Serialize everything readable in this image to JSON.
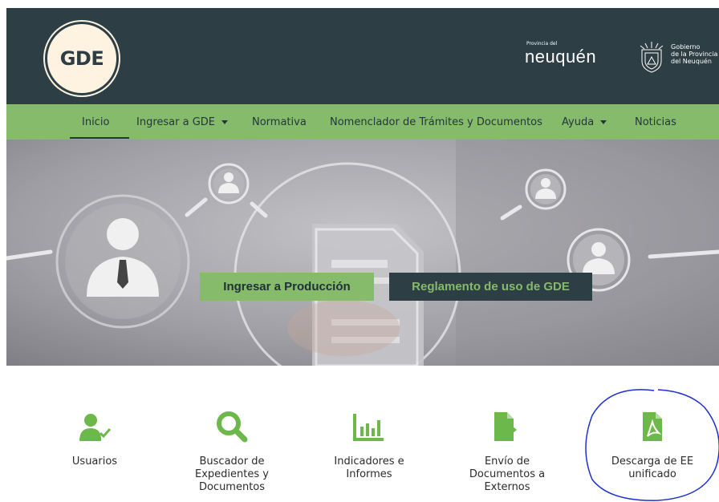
{
  "header": {
    "logo_text": "GDE",
    "province_small": "Provincia del",
    "province_name": "neuquén",
    "gov_line1": "Gobierno",
    "gov_line2": "de la Provincia",
    "gov_line3": "del Neuquén"
  },
  "nav": {
    "items": [
      {
        "label": "Inicio",
        "active": true
      },
      {
        "label": "Ingresar a GDE",
        "dropdown": true
      },
      {
        "label": "Normativa"
      },
      {
        "label": "Nomenclador de Trámites y Documentos"
      },
      {
        "label": "Ayuda",
        "dropdown": true
      },
      {
        "label": "Noticias"
      }
    ]
  },
  "hero": {
    "primary_button": "Ingresar a Producción",
    "secondary_button": "Reglamento de uso de GDE"
  },
  "quick_links": [
    {
      "label": "Usuarios",
      "icon": "user-check-icon"
    },
    {
      "label": "Buscador de Expedientes y Documentos",
      "icon": "search-icon"
    },
    {
      "label": "Indicadores e Informes",
      "icon": "bar-chart-icon"
    },
    {
      "label": "Envío de Documentos a Externos",
      "icon": "file-export-icon"
    },
    {
      "label": "Descarga de EE unificado",
      "icon": "file-pdf-icon"
    }
  ],
  "colors": {
    "dark": "#2d3e44",
    "green": "#86bb6b",
    "icon_green": "#6cb84a",
    "annotation": "#1c2fd1"
  }
}
